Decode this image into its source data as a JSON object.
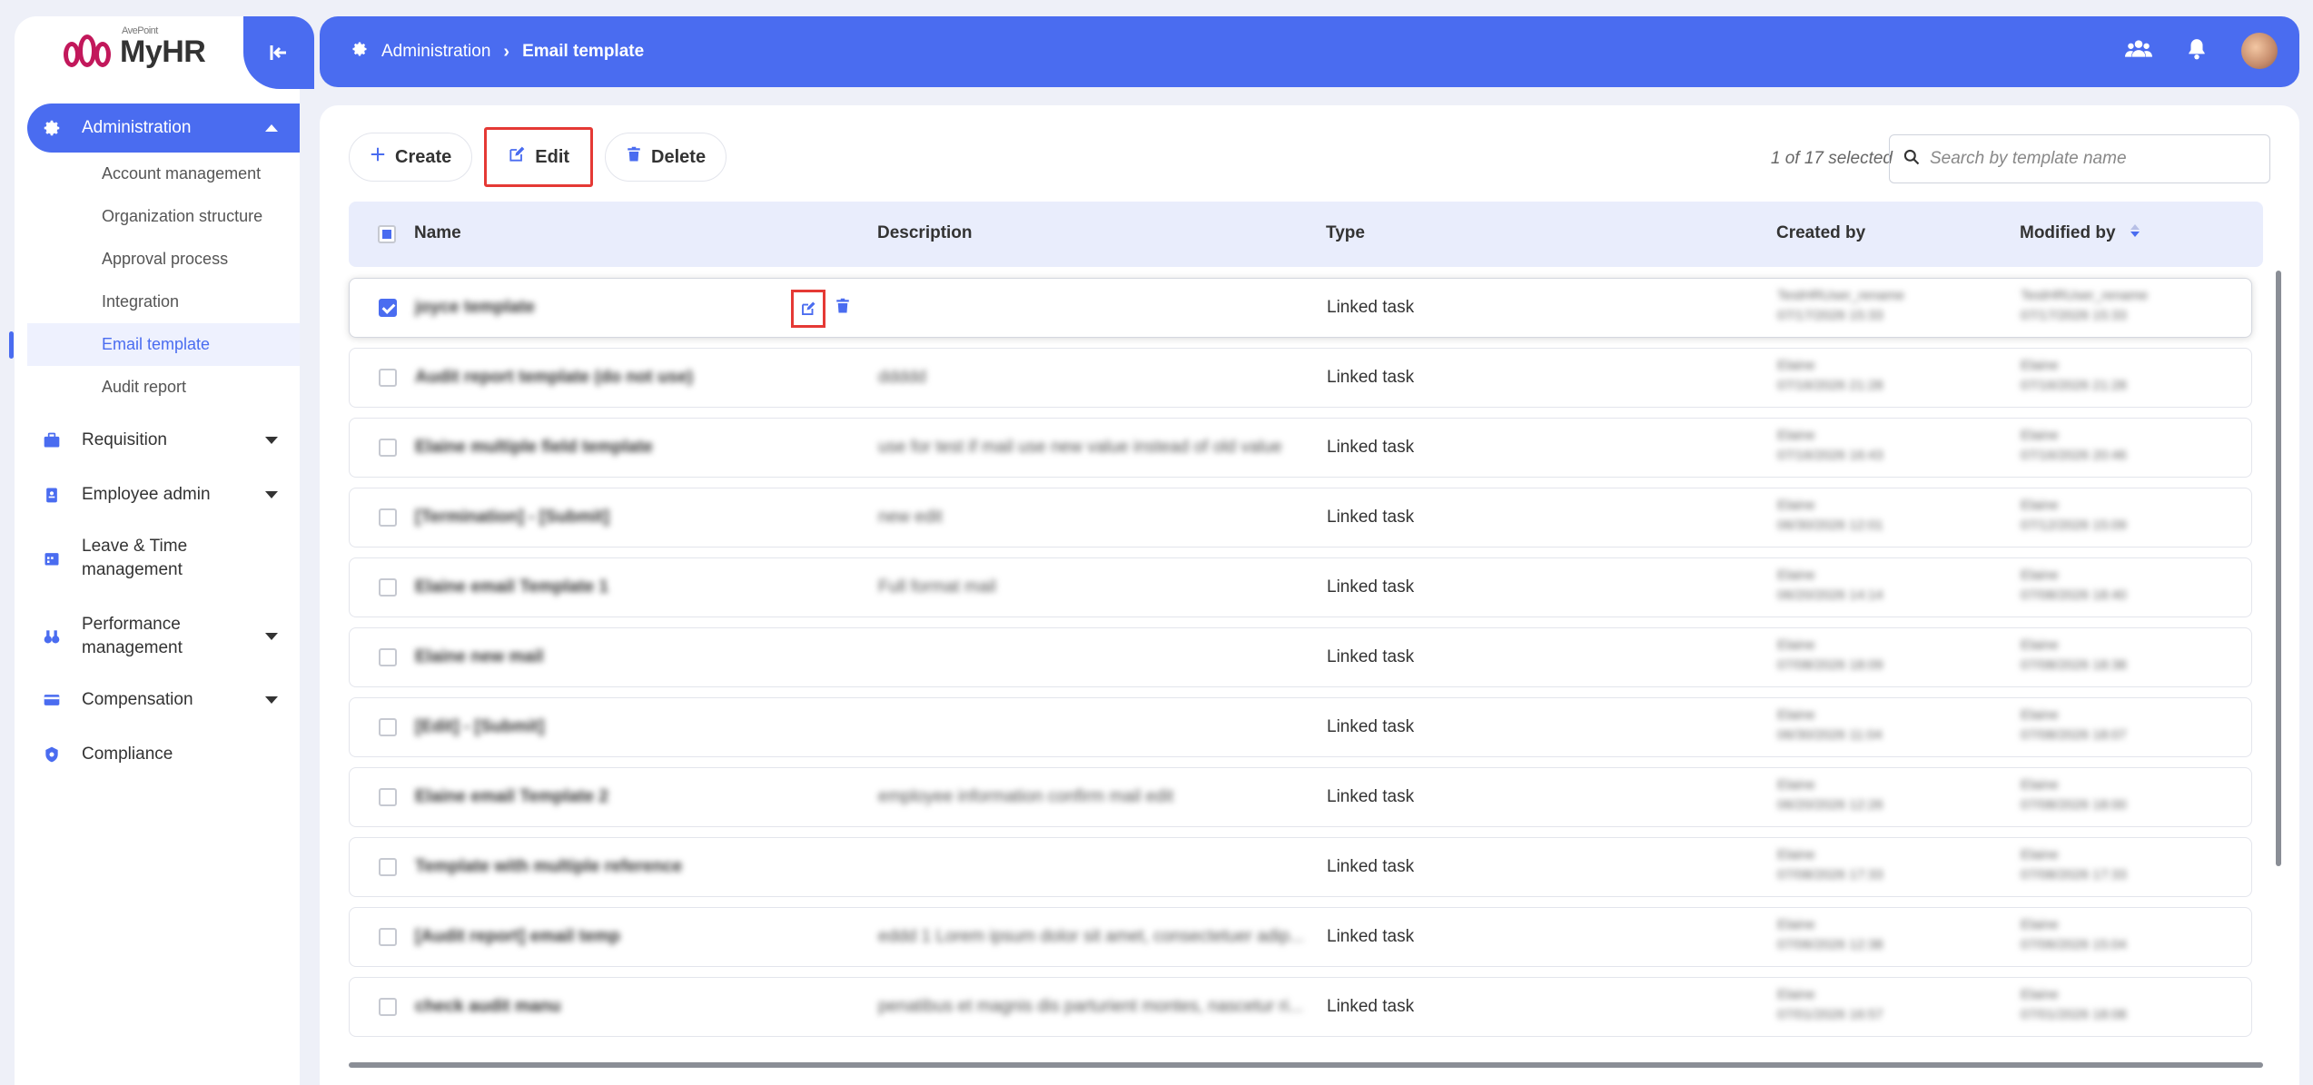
{
  "brand": {
    "name": "MyHR",
    "vendor": "AvePoint"
  },
  "sidebar": {
    "groups": [
      {
        "label": "Administration",
        "icon": "gear-icon",
        "expanded": true,
        "active": true,
        "items": [
          {
            "label": "Account management"
          },
          {
            "label": "Organization structure"
          },
          {
            "label": "Approval process"
          },
          {
            "label": "Integration"
          },
          {
            "label": "Email template",
            "selected": true
          },
          {
            "label": "Audit report"
          }
        ]
      },
      {
        "label": "Requisition",
        "icon": "briefcase-icon",
        "has_caret": true
      },
      {
        "label": "Employee admin",
        "icon": "clipboard-icon",
        "has_caret": true
      },
      {
        "label": "Leave & Time management",
        "line1": "Leave & Time",
        "line2": "management",
        "icon": "calendar-icon"
      },
      {
        "label": "Performance management",
        "line1": "Performance",
        "line2": "management",
        "icon": "binoculars-icon",
        "has_caret": true
      },
      {
        "label": "Compensation",
        "icon": "card-icon",
        "has_caret": true
      },
      {
        "label": "Compliance",
        "icon": "badge-icon"
      }
    ]
  },
  "header": {
    "breadcrumb": [
      "Administration",
      "Email template"
    ],
    "icons": [
      "team-icon",
      "bell-icon",
      "avatar"
    ]
  },
  "toolbar": {
    "create_label": "Create",
    "edit_label": "Edit",
    "delete_label": "Delete",
    "selection_status": "1 of 17 selected",
    "search_placeholder": "Search by template name"
  },
  "table": {
    "columns": [
      "Name",
      "Description",
      "Type",
      "Created by",
      "Modified by"
    ],
    "rows": [
      {
        "name": "joyce template",
        "description": "",
        "type": "Linked task",
        "created_by": "TestHRUser_rename",
        "created_at": "07/17/2026 15:33",
        "modified_by": "TestHRUser_rename",
        "modified_at": "07/17/2026 15:33",
        "checked": true
      },
      {
        "name": "Audit report template (do not use)",
        "description": "ddddd",
        "type": "Linked task",
        "created_by": "Elaine",
        "created_at": "07/16/2026 21:28",
        "modified_by": "Elaine",
        "modified_at": "07/16/2026 21:28"
      },
      {
        "name": "Elaine multiple field template",
        "description": "use for test if mail use new value instead of old value",
        "type": "Linked task",
        "created_by": "Elaine",
        "created_at": "07/16/2026 16:43",
        "modified_by": "Elaine",
        "modified_at": "07/16/2026 20:46"
      },
      {
        "name": "[Termination] - [Submit]",
        "description": "new edit",
        "type": "Linked task",
        "created_by": "Elaine",
        "created_at": "06/30/2026 12:01",
        "modified_by": "Elaine",
        "modified_at": "07/12/2026 15:09"
      },
      {
        "name": "Elaine email Template 1",
        "description": "Full format mail",
        "type": "Linked task",
        "created_by": "Elaine",
        "created_at": "06/20/2026 14:14",
        "modified_by": "Elaine",
        "modified_at": "07/08/2026 18:40"
      },
      {
        "name": "Elaine new mail",
        "description": "",
        "type": "Linked task",
        "created_by": "Elaine",
        "created_at": "07/08/2026 18:09",
        "modified_by": "Elaine",
        "modified_at": "07/08/2026 18:38"
      },
      {
        "name": "[Edit] - [Submit]",
        "description": "",
        "type": "Linked task",
        "created_by": "Elaine",
        "created_at": "06/30/2026 11:04",
        "modified_by": "Elaine",
        "modified_at": "07/08/2026 18:07"
      },
      {
        "name": "Elaine email Template 2",
        "description": "employee information confirm mail edit",
        "type": "Linked task",
        "created_by": "Elaine",
        "created_at": "06/20/2026 12:26",
        "modified_by": "Elaine",
        "modified_at": "07/08/2026 18:00"
      },
      {
        "name": "Template with multiple reference",
        "description": "",
        "type": "Linked task",
        "created_by": "Elaine",
        "created_at": "07/08/2026 17:33",
        "modified_by": "Elaine",
        "modified_at": "07/08/2026 17:33"
      },
      {
        "name": "[Audit report] email temp",
        "description": "eddd 1 Lorem ipsum dolor sit amet, consectetuer adip...",
        "type": "Linked task",
        "created_by": "Elaine",
        "created_at": "07/06/2026 12:38",
        "modified_by": "Elaine",
        "modified_at": "07/06/2026 15:04"
      },
      {
        "name": "check audit manu",
        "description": "penatibus et magnis dis parturient montes, nascetur ri...",
        "type": "Linked task",
        "created_by": "Elaine",
        "created_at": "07/01/2026 16:57",
        "modified_by": "Elaine",
        "modified_at": "07/01/2026 18:08"
      }
    ]
  },
  "colors": {
    "primary": "#4a6cf0",
    "highlight": "#e53935",
    "header_bg": "#e9edfc"
  }
}
